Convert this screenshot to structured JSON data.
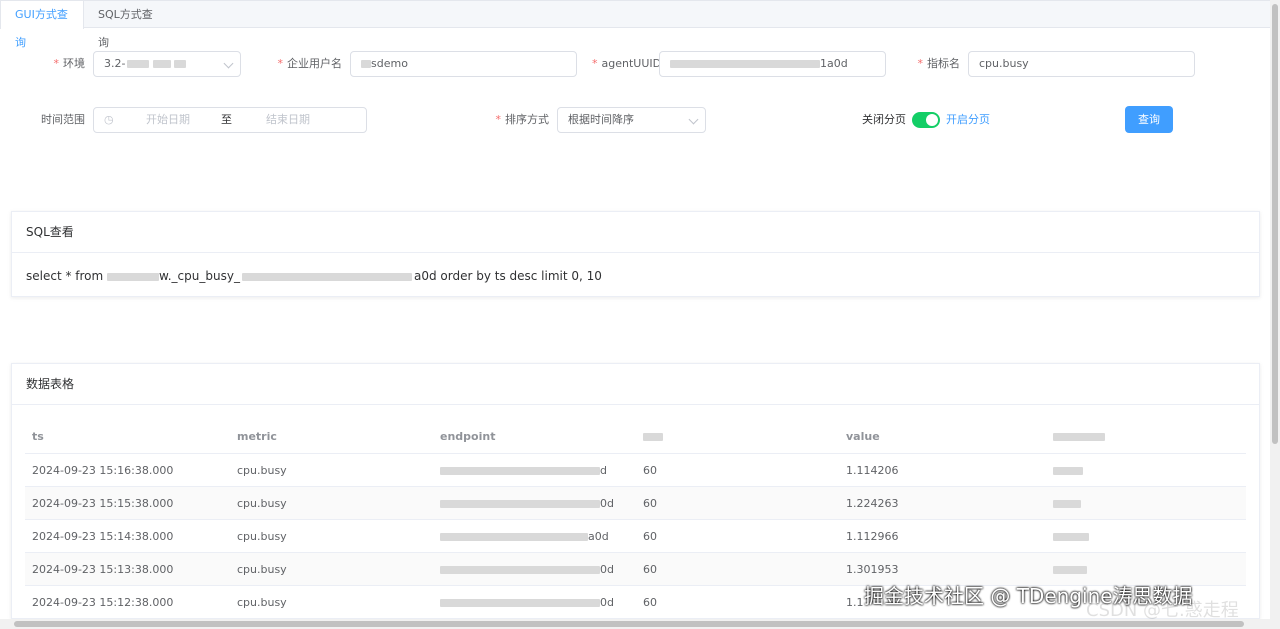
{
  "tabs": [
    {
      "label": "GUI方式查询",
      "active": true
    },
    {
      "label": "SQL方式查询",
      "active": false
    }
  ],
  "form": {
    "env": {
      "label": "环境",
      "value": "3.2-"
    },
    "company": {
      "label": "企业用户名",
      "value": "sdemo"
    },
    "agent": {
      "label": "agentUUID",
      "value": "1a0d"
    },
    "metric": {
      "label": "指标名",
      "value": "cpu.busy"
    },
    "time_range": {
      "label": "时间范围",
      "start_placeholder": "开始日期",
      "separator": "至",
      "end_placeholder": "结束日期"
    },
    "sort": {
      "label": "排序方式",
      "value": "根据时间降序"
    },
    "paging": {
      "off_label": "关闭分页",
      "on_label": "开启分页",
      "enabled": true
    },
    "query_button": "查询"
  },
  "sql_card": {
    "title": "SQL查看",
    "sql_prefix": "select * from ",
    "sql_mid": "w._cpu_busy_",
    "sql_suffix": "a0d order by ts desc limit 0, 10"
  },
  "table_card": {
    "title": "数据表格",
    "columns": [
      "ts",
      "metric",
      "endpoint",
      "",
      "value",
      ""
    ],
    "rows": [
      {
        "ts": "2024-09-23 15:16:38.000",
        "metric": "cpu.busy",
        "endpoint_tail": "d",
        "count": "60",
        "value": "1.114206"
      },
      {
        "ts": "2024-09-23 15:15:38.000",
        "metric": "cpu.busy",
        "endpoint_tail": "0d",
        "count": "60",
        "value": "1.224263"
      },
      {
        "ts": "2024-09-23 15:14:38.000",
        "metric": "cpu.busy",
        "endpoint_tail": "a0d",
        "count": "60",
        "value": "1.112966"
      },
      {
        "ts": "2024-09-23 15:13:38.000",
        "metric": "cpu.busy",
        "endpoint_tail": "0d",
        "count": "60",
        "value": "1.301953"
      },
      {
        "ts": "2024-09-23 15:12:38.000",
        "metric": "cpu.busy",
        "endpoint_tail": "0d",
        "count": "60",
        "value": "1.1"
      }
    ]
  },
  "watermark": "掘金技术社区 @ TDengine涛思数据",
  "watermark2": "CSDN @七.惑走程",
  "colors": {
    "primary": "#409eff",
    "switch_on": "#13ce66",
    "required": "#f56c6c"
  }
}
